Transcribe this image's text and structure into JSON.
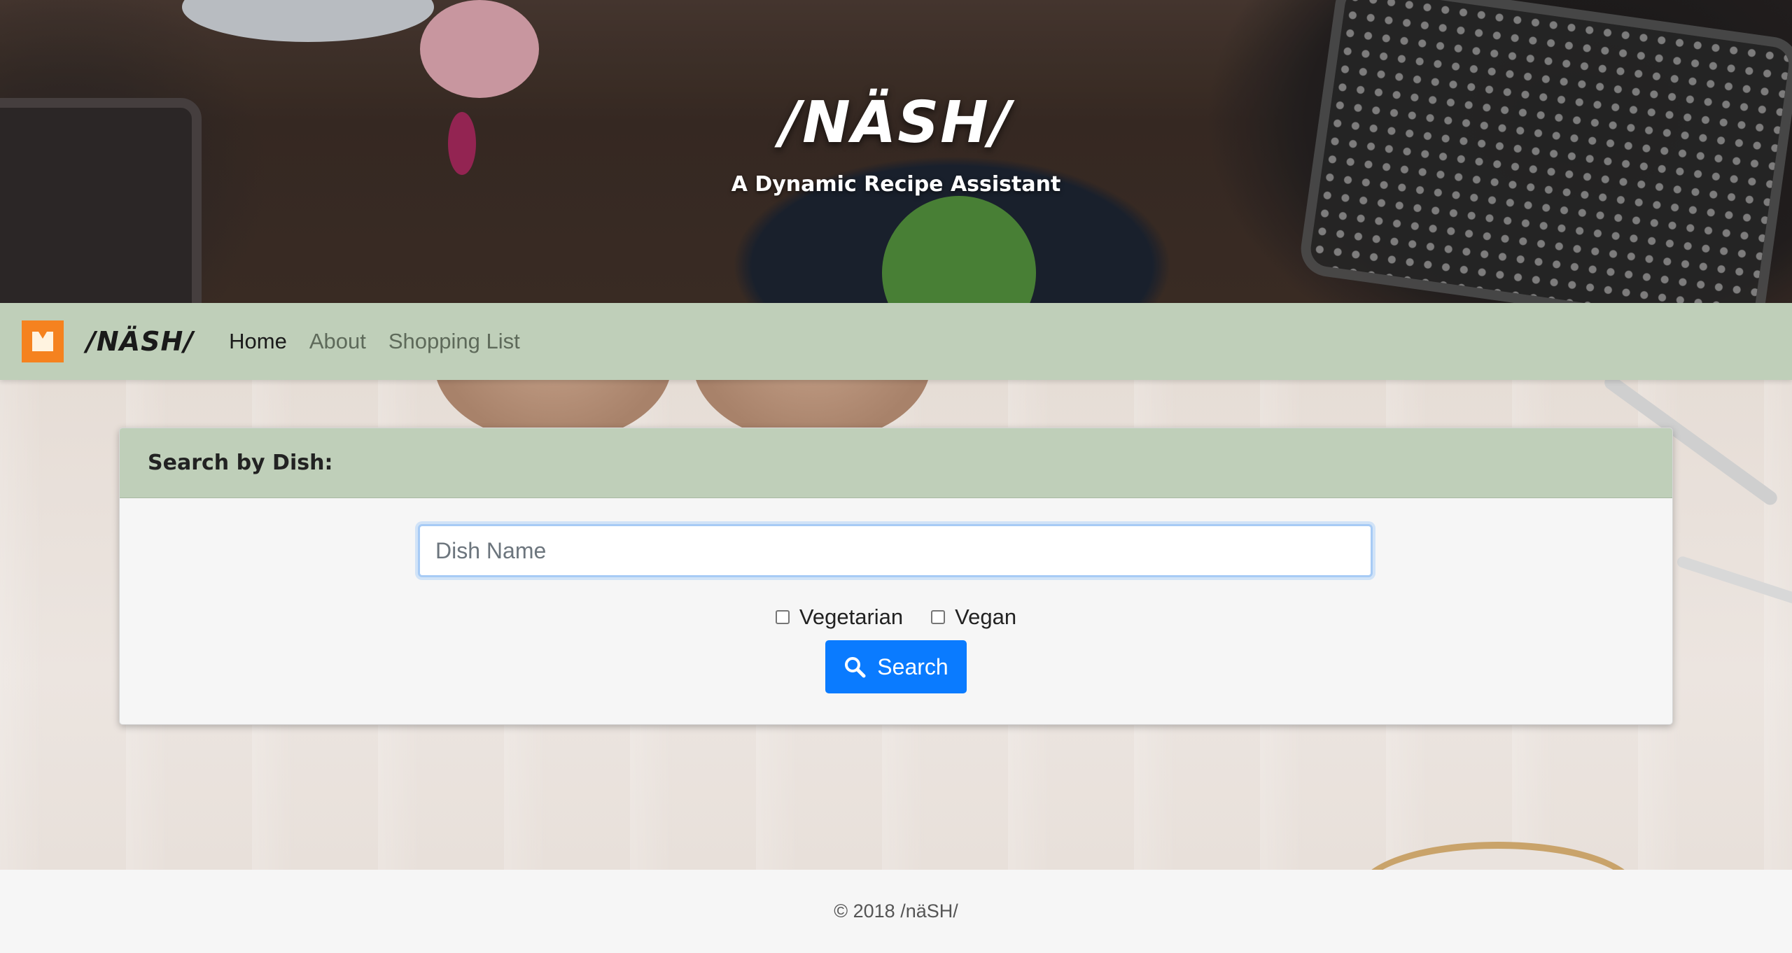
{
  "hero": {
    "title": "/NÄSH/",
    "subtitle": "A Dynamic Recipe Assistant"
  },
  "navbar": {
    "brand": "/NÄSH/",
    "logo_icon": "book-icon",
    "links": [
      {
        "label": "Home",
        "active": true
      },
      {
        "label": "About",
        "active": false
      },
      {
        "label": "Shopping List",
        "active": false
      }
    ]
  },
  "search_card": {
    "header": "Search by Dish:",
    "input": {
      "placeholder": "Dish Name",
      "value": ""
    },
    "options": [
      {
        "label": "Vegetarian",
        "checked": false
      },
      {
        "label": "Vegan",
        "checked": false
      }
    ],
    "button": {
      "label": "Search",
      "icon": "search-icon"
    }
  },
  "footer": {
    "text": "© 2018 /näSH/"
  },
  "colors": {
    "nav_bg": "#bfcfb9",
    "accent": "#0a7bff",
    "logo": "#f5821f"
  }
}
